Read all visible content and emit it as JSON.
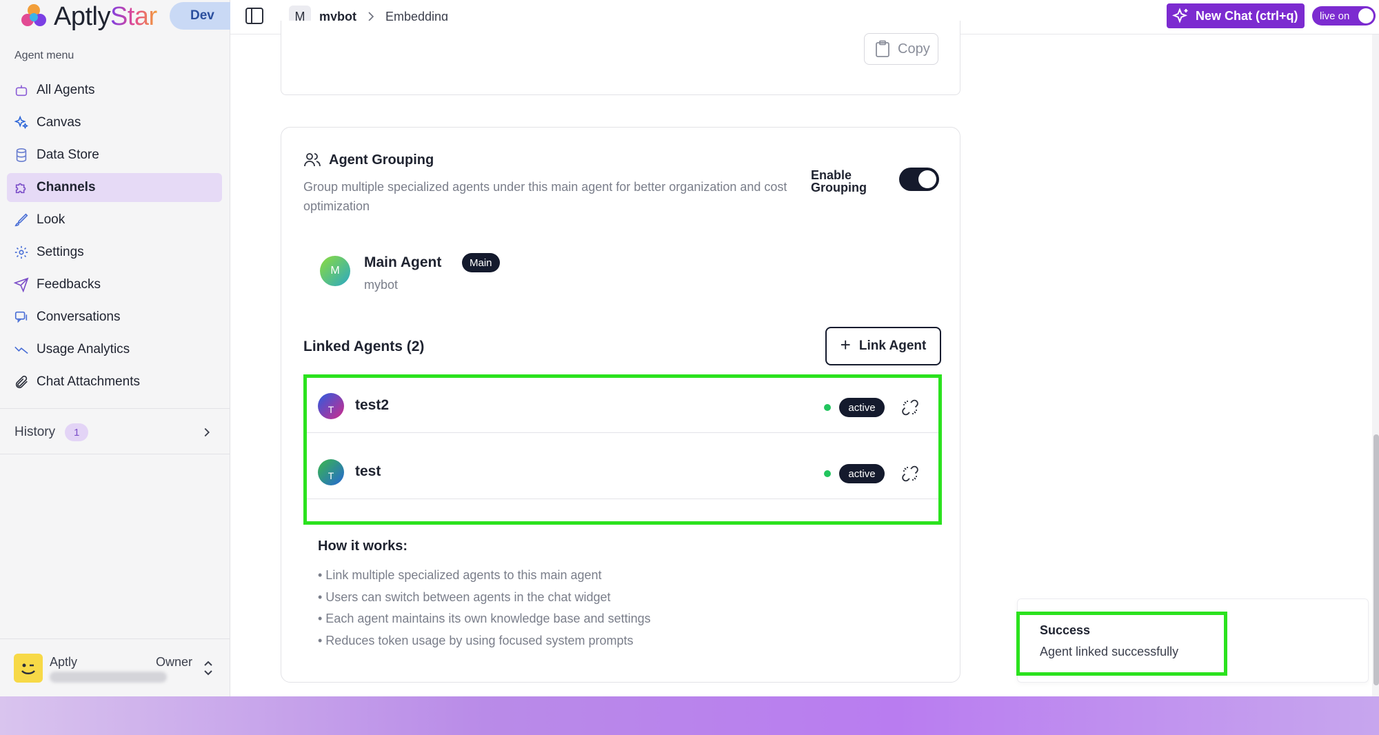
{
  "brand": {
    "name_a": "Aptly",
    "name_b": "Star",
    "env_badge": "Dev"
  },
  "sidebar": {
    "menu_title": "Agent menu",
    "items": [
      {
        "label": "All Agents",
        "icon": "bot-icon"
      },
      {
        "label": "Canvas",
        "icon": "sparkles-icon"
      },
      {
        "label": "Data Store",
        "icon": "database-icon"
      },
      {
        "label": "Channels",
        "icon": "puzzle-icon",
        "active": true
      },
      {
        "label": "Look",
        "icon": "brush-icon"
      },
      {
        "label": "Settings",
        "icon": "gear-icon"
      },
      {
        "label": "Feedbacks",
        "icon": "send-icon"
      },
      {
        "label": "Conversations",
        "icon": "chat-icon"
      },
      {
        "label": "Usage Analytics",
        "icon": "trend-icon"
      },
      {
        "label": "Chat Attachments",
        "icon": "paperclip-icon"
      }
    ],
    "history": {
      "label": "History",
      "count": "1"
    },
    "user": {
      "name": "Aptly",
      "role": "Owner"
    }
  },
  "topbar": {
    "bot_initial": "M",
    "bot_name": "mybot",
    "page": "Embedding",
    "new_chat_label": "New Chat (ctrl+q)",
    "live_label": "live on"
  },
  "embed": {
    "copy_label": "Copy"
  },
  "grouping": {
    "title": "Agent Grouping",
    "description": "Group multiple specialized agents under this main agent for better organization and cost optimization",
    "enable_label_1": "Enable",
    "enable_label_2": "Grouping",
    "enabled": true,
    "main_agent": {
      "initial": "M",
      "name": "Main Agent",
      "badge": "Main",
      "sub": "mybot"
    },
    "linked_title": "Linked Agents (2)",
    "link_button": "Link Agent",
    "linked_agents": [
      {
        "initial": "T",
        "name": "test2",
        "status": "active",
        "gradient_from": "#2b5de0",
        "gradient_to": "#d12a8a"
      },
      {
        "initial": "T",
        "name": "test",
        "status": "active",
        "gradient_from": "#3bb84a",
        "gradient_to": "#2566d6"
      }
    ],
    "how_title": "How it works:",
    "how_items": [
      "• Link multiple specialized agents to this main agent",
      "• Users can switch between agents in the chat widget",
      "• Each agent maintains its own knowledge base and settings",
      "• Reduces token usage by using focused system prompts"
    ]
  },
  "toast": {
    "title": "Success",
    "message": "Agent linked successfully"
  },
  "colors": {
    "accent": "#7c2bd0",
    "highlight": "#2be21e",
    "dark": "#141a2d",
    "active_dot": "#22c55e"
  }
}
